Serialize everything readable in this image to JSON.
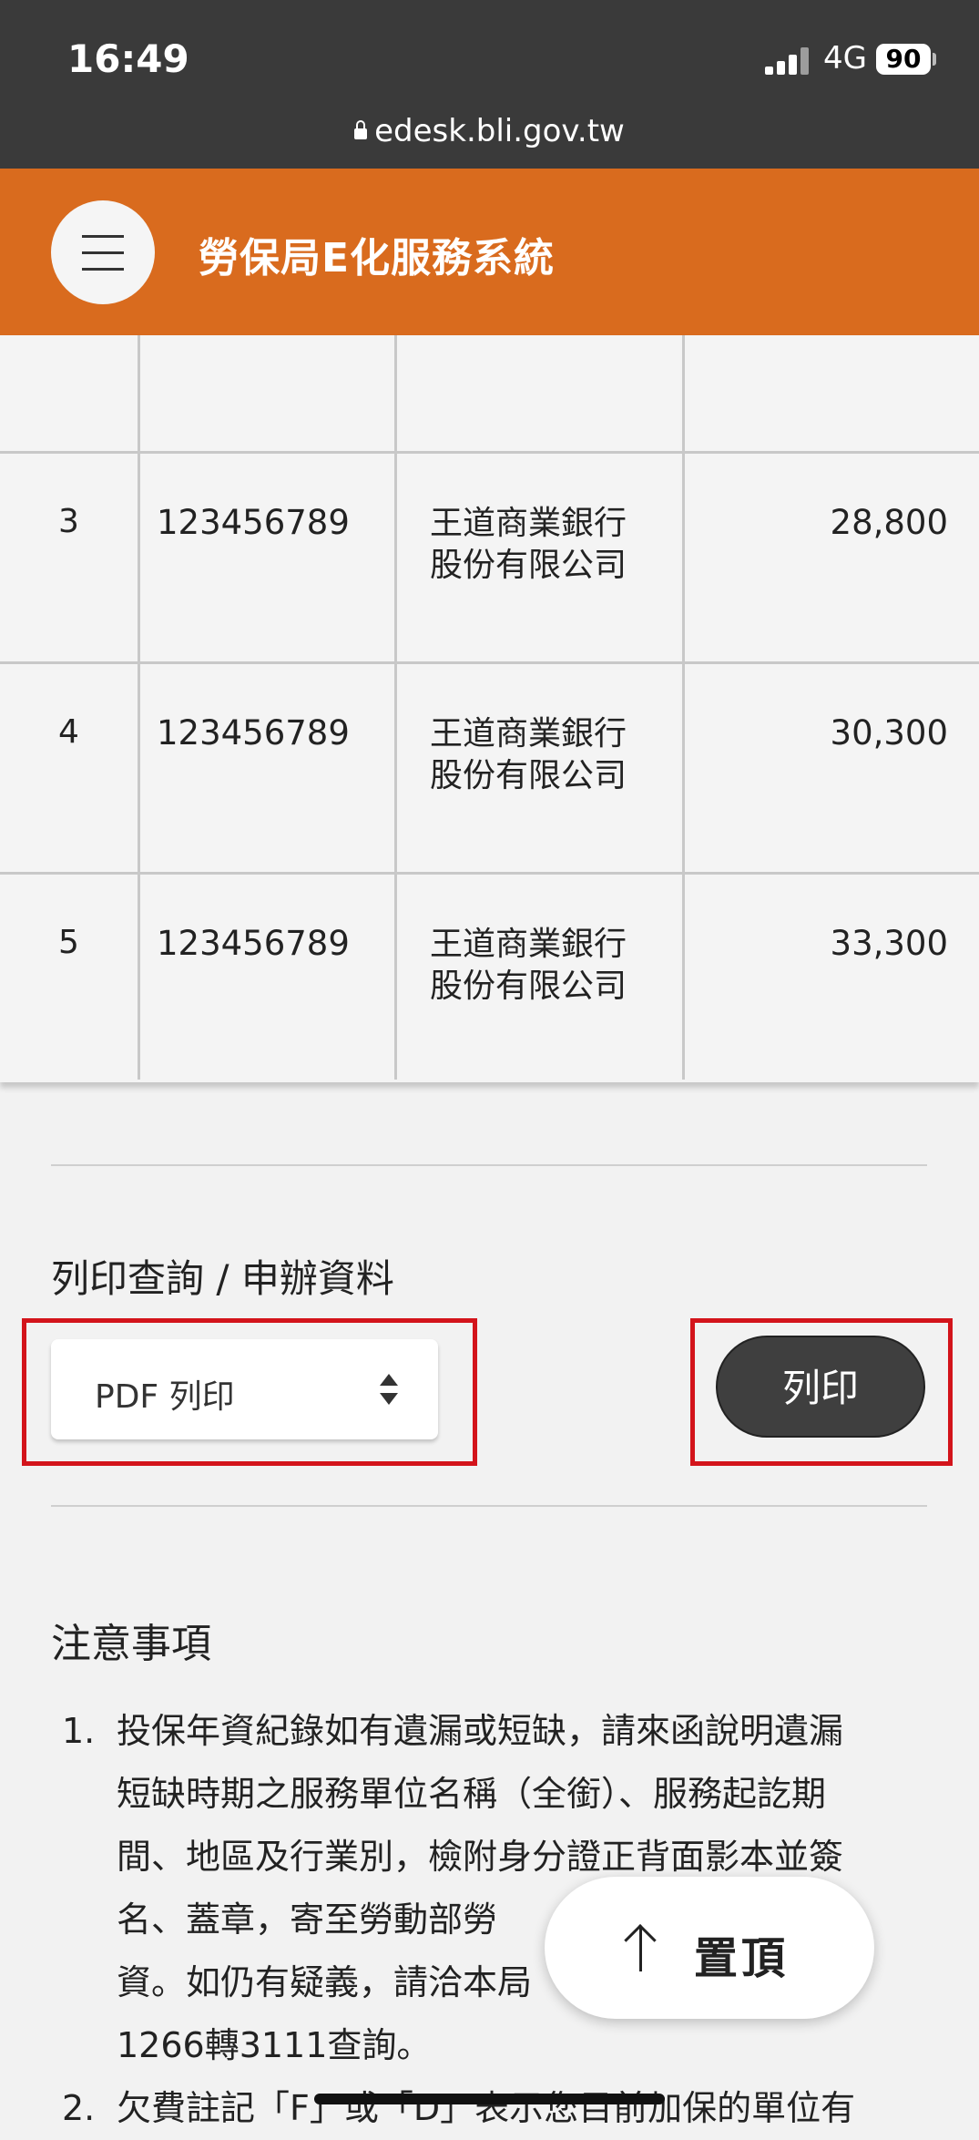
{
  "status_bar": {
    "time": "16:49",
    "network": "4G",
    "battery": "90"
  },
  "browser": {
    "url": "edesk.bli.gov.tw"
  },
  "header": {
    "title": "勞保局E化服務系統",
    "menu_icon": "hamburger-icon"
  },
  "table": {
    "rows": [
      {
        "index": "",
        "id": "",
        "name_line1": "",
        "name_line2": "",
        "amount": ""
      },
      {
        "index": "3",
        "id": "123456789",
        "name_line1": "王道商業銀行",
        "name_line2": "股份有限公司",
        "amount": "28,800"
      },
      {
        "index": "4",
        "id": "123456789",
        "name_line1": "王道商業銀行",
        "name_line2": "股份有限公司",
        "amount": "30,300"
      },
      {
        "index": "5",
        "id": "123456789",
        "name_line1": "王道商業銀行",
        "name_line2": "股份有限公司",
        "amount": "33,300"
      }
    ]
  },
  "print_section": {
    "label": "列印查詢 / 申辦資料",
    "select_value": "PDF 列印",
    "print_button": "列印",
    "highlight_color": "#d3141b"
  },
  "notice": {
    "title": "注意事項",
    "items": [
      {
        "number": "1.",
        "lines": [
          "投保年資紀錄如有遺漏或短缺，請來函說明遺漏",
          "短缺時期之服務單位名稱（全銜）、服務起訖期",
          "間、地區及行業別，檢附身分證正背面影本並簽",
          "名、蓋章，寄至勞動部勞",
          "資。如仍有疑義，請洽本局",
          "1266轉3111查詢。"
        ]
      },
      {
        "number": "2.",
        "lines": [
          "欠費註記「F」或「D」表示您目前加保的單位有"
        ]
      }
    ]
  },
  "back_to_top": {
    "label": "置頂",
    "icon": "arrow-up-icon"
  },
  "colors": {
    "header": "#d96b1e",
    "status_bar": "#3a3a3a",
    "button": "#3f3f3f"
  }
}
